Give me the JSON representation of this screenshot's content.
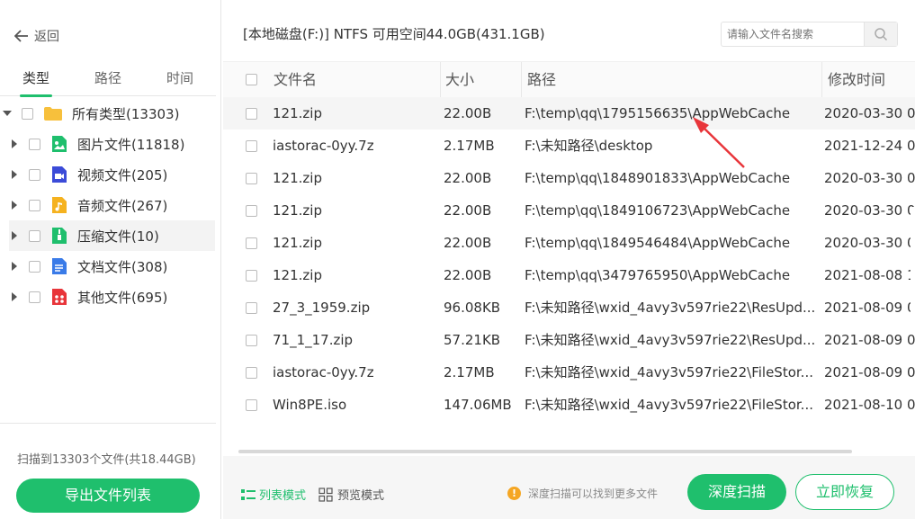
{
  "nav": {
    "back_label": "返回"
  },
  "tabs": [
    {
      "label": "类型"
    },
    {
      "label": "路径"
    },
    {
      "label": "时间"
    }
  ],
  "tree": {
    "root": {
      "label": "所有类型(13303)"
    },
    "items": [
      {
        "label": "图片文件(11818)",
        "icon": "image-file-icon",
        "color": "#1fbf6d"
      },
      {
        "label": "视频文件(205)",
        "icon": "video-file-icon",
        "color": "#3b4bd8"
      },
      {
        "label": "音频文件(267)",
        "icon": "audio-file-icon",
        "color": "#f5b21f"
      },
      {
        "label": "压缩文件(10)",
        "icon": "archive-file-icon",
        "color": "#1fbf6d"
      },
      {
        "label": "文档文件(308)",
        "icon": "document-file-icon",
        "color": "#3a7be8"
      },
      {
        "label": "其他文件(695)",
        "icon": "other-file-icon",
        "color": "#e8353a"
      }
    ]
  },
  "scan_summary": "扫描到13303个文件(共18.44GB)",
  "export_label": "导出文件列表",
  "disk_info": "[本地磁盘(F:)] NTFS 可用空间44.0GB(431.1GB)",
  "search": {
    "placeholder": "请输入文件名搜索"
  },
  "table": {
    "headers": {
      "name": "文件名",
      "size": "大小",
      "path": "路径",
      "modified": "修改时间"
    },
    "rows": [
      {
        "name": "121.zip",
        "size": "22.00B",
        "path": "F:\\temp\\qq\\1795156635\\AppWebCache",
        "modified": "2020-03-30 0"
      },
      {
        "name": "iastorac-0yy.7z",
        "size": "2.17MB",
        "path": "F:\\未知路径\\desktop",
        "modified": "2021-12-24 0"
      },
      {
        "name": "121.zip",
        "size": "22.00B",
        "path": "F:\\temp\\qq\\1848901833\\AppWebCache",
        "modified": "2020-03-30 0"
      },
      {
        "name": "121.zip",
        "size": "22.00B",
        "path": "F:\\temp\\qq\\1849106723\\AppWebCache",
        "modified": "2020-03-30 0"
      },
      {
        "name": "121.zip",
        "size": "22.00B",
        "path": "F:\\temp\\qq\\1849546484\\AppWebCache",
        "modified": "2020-03-30 0"
      },
      {
        "name": "121.zip",
        "size": "22.00B",
        "path": "F:\\temp\\qq\\3479765950\\AppWebCache",
        "modified": "2021-08-08 1"
      },
      {
        "name": "27_3_1959.zip",
        "size": "96.08KB",
        "path": "F:\\未知路径\\wxid_4avy3v597rie22\\ResUpd...",
        "modified": "2021-08-09 0"
      },
      {
        "name": "71_1_17.zip",
        "size": "57.21KB",
        "path": "F:\\未知路径\\wxid_4avy3v597rie22\\ResUpd...",
        "modified": "2021-08-09 0"
      },
      {
        "name": "iastorac-0yy.7z",
        "size": "2.17MB",
        "path": "F:\\未知路径\\wxid_4avy3v597rie22\\FileStor...",
        "modified": "2021-08-09 0"
      },
      {
        "name": "Win8PE.iso",
        "size": "147.06MB",
        "path": "F:\\未知路径\\wxid_4avy3v597rie22\\FileStor...",
        "modified": "2021-08-10 0"
      }
    ]
  },
  "modes": {
    "list_label": "列表模式",
    "preview_label": "预览模式"
  },
  "tip": "深度扫描可以找到更多文件",
  "deep_scan_label": "深度扫描",
  "recover_label": "立即恢复",
  "colors": {
    "accent": "#1fbf6d",
    "annotation": "#e8353a",
    "warning": "#f5a623"
  }
}
